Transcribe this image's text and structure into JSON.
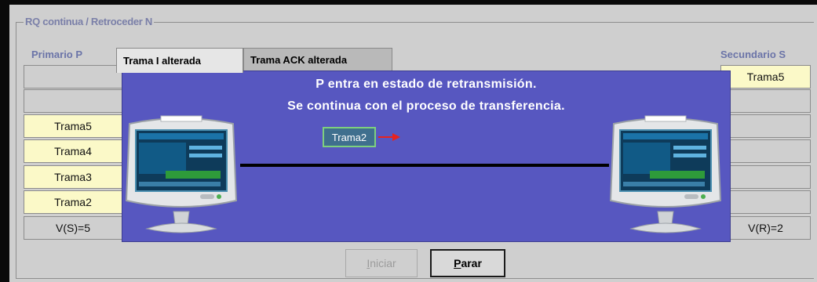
{
  "group": {
    "title": "RQ continua / Retroceder N"
  },
  "primary": {
    "label": "Primario P",
    "slots": [
      "",
      "",
      "Trama5",
      "Trama4",
      "Trama3",
      "Trama2"
    ],
    "register": "V(S)=5"
  },
  "secondary": {
    "label": "Secundario S",
    "slots": [
      "Trama5",
      "",
      "",
      "",
      "",
      ""
    ],
    "register": "V(R)=2"
  },
  "tabs": [
    {
      "label": "Trama I alterada",
      "active": true
    },
    {
      "label": "Trama ACK alterada",
      "active": false
    }
  ],
  "stage": {
    "message_line1": "P entra en estado de retransmisión.",
    "message_line2": "Se continua con el proceso de transferencia.",
    "frame_label": "Trama2",
    "arrow_color": "#e8231e",
    "background": "#5757c0"
  },
  "buttons": {
    "start": {
      "first": "I",
      "rest": "niciar",
      "enabled": false
    },
    "stop": {
      "first": "P",
      "rest": "arar",
      "enabled": true
    }
  }
}
